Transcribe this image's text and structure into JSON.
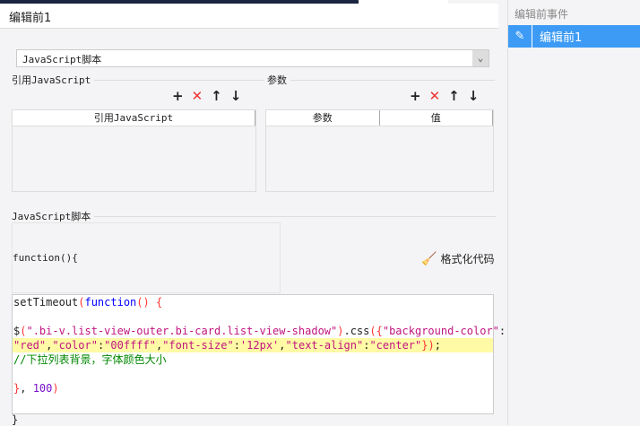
{
  "header": {
    "title": "编辑前1"
  },
  "right_panel": {
    "title": "编辑前事件",
    "items": [
      {
        "label": "编辑前1",
        "icon": "pencil-icon"
      }
    ]
  },
  "select": {
    "value": "JavaScript脚本"
  },
  "ref_section": {
    "label": "引用JavaScript",
    "columns": [
      "引用JavaScript"
    ]
  },
  "param_section": {
    "label": "参数",
    "columns": [
      "参数",
      "值"
    ]
  },
  "toolbar": {
    "add": "+",
    "delete": "✕",
    "up": "🡑",
    "down": "🡓"
  },
  "script_section": {
    "label": "JavaScript脚本",
    "func_open": "function(){",
    "func_close": "}"
  },
  "format_button": {
    "label": "格式化代码"
  },
  "code": {
    "l1a": "setTimeout",
    "l1b": "(",
    "l1c": "function",
    "l1d": "() {",
    "l3a": "$",
    "l3b": "(",
    "l3c": "\".bi-v.list-view-outer.bi-card.list-view-shadow\"",
    "l3d": ")",
    ".css": ".css",
    "l3e": "({",
    "l3f": "\"background-color\"",
    "l3g": ":",
    "l4a": "\"red\"",
    "l4b": ",",
    "l4c": "\"color\"",
    "l4d": ":",
    "l4e": "\"00ffff\"",
    "l4f": ",",
    "l4g": "\"font-size\"",
    "l4h": ":",
    "l4i": "'12px'",
    "l4j": ",",
    "l4k": "\"text-align\"",
    "l4l": ":",
    "l4m": "\"center\"",
    "l4n": "})",
    "l4o": ";",
    "l5": "//下拉列表背景，字体颜色大小",
    "l7a": "}",
    ",": ", ",
    "l7b": "100",
    "l7c": ")"
  }
}
